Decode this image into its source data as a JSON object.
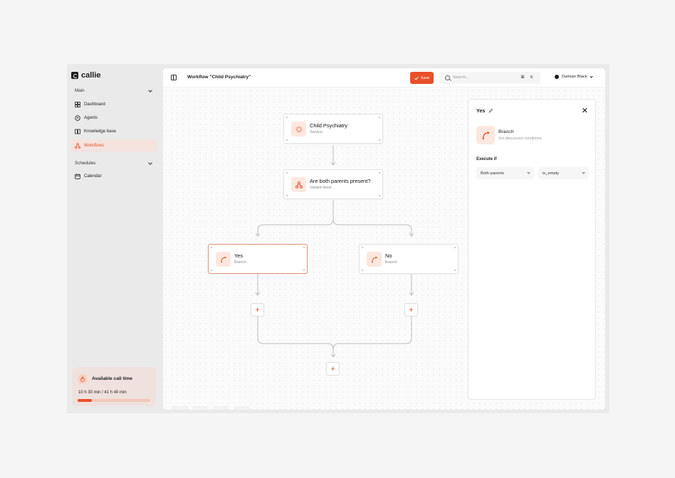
{
  "brand": {
    "name": "callie"
  },
  "sidebar": {
    "main_section": "Main",
    "items": [
      {
        "label": "Dashboard",
        "icon": "dashboard-icon"
      },
      {
        "label": "Agents",
        "icon": "agents-icon"
      },
      {
        "label": "Knowledge base",
        "icon": "book-icon"
      },
      {
        "label": "Workflows",
        "icon": "workflow-icon",
        "active": true
      }
    ],
    "schedules_section": "Schedules",
    "schedule_items": [
      {
        "label": "Calendar",
        "icon": "calendar-icon"
      }
    ],
    "call_time": {
      "title": "Available call time",
      "value": "10 h 30 min / 41 h 40 min",
      "progress": 0.2
    }
  },
  "header": {
    "title": "Workflow \"Child Psychiatry\"",
    "save_label": "Save",
    "search_placeholder": "Search...",
    "shortcut_cmd": "⌘",
    "shortcut_key": "K",
    "user_name": "Damian Black"
  },
  "canvas": {
    "nodes": [
      {
        "title": "Child Psychiatry",
        "subtitle": "Service"
      },
      {
        "title": "Are both parents present?",
        "subtitle": "Variant block"
      },
      {
        "title": "Yes",
        "subtitle": "Branch"
      },
      {
        "title": "No",
        "subtitle": "Branch"
      }
    ],
    "plus_label": "+"
  },
  "panel": {
    "title": "Yes",
    "block_name": "Branch",
    "block_desc": "Set discussion conditions",
    "execute_label": "Execute if",
    "condition_field": "Both parents",
    "condition_op": "is_empty"
  },
  "colors": {
    "accent": "#e8512a",
    "accent_soft": "#fde7df"
  }
}
